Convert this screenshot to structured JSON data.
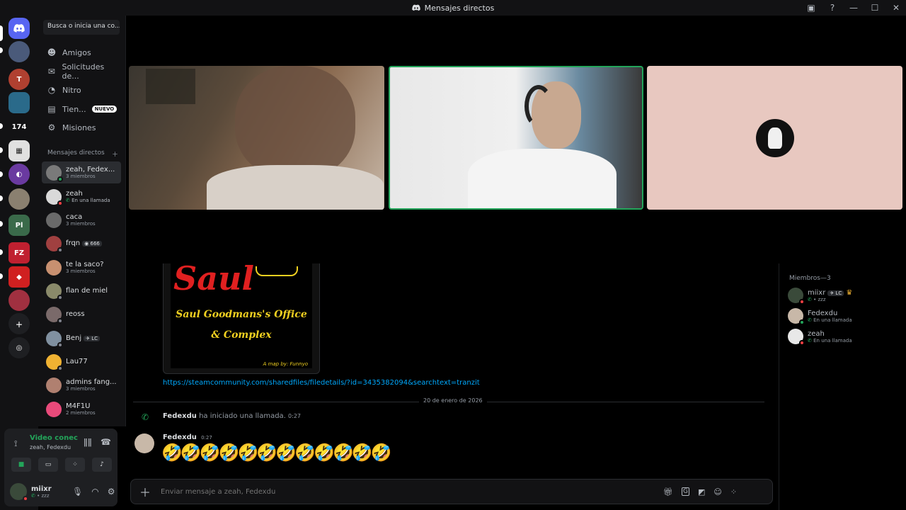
{
  "titlebar": {
    "title": "Mensajes directos"
  },
  "sidebar": {
    "search_label": "Busca o inicia una co...",
    "nav": [
      {
        "label": "Amigos",
        "icon": "friends-icon"
      },
      {
        "label": "Solicitudes de...",
        "icon": "mail-icon"
      },
      {
        "label": "Nitro",
        "icon": "nitro-icon"
      },
      {
        "label": "Tien...",
        "icon": "shop-icon",
        "badge": "NUEVO"
      },
      {
        "label": "Misiones",
        "icon": "quests-icon"
      }
    ],
    "dm_header": "Mensajes directos",
    "dms": [
      {
        "name": "zeah, Fedex...",
        "sub": "3 miembros",
        "color": "#7a7a7a"
      },
      {
        "name": "zeah",
        "sub": "En una llamada",
        "color": "#d9d9d9"
      },
      {
        "name": "caca",
        "sub": "3 miembros",
        "color": "#6a6a6a"
      },
      {
        "name": "frqn",
        "sub": "",
        "tag": "666",
        "color": "#a04040"
      },
      {
        "name": "te la saco?",
        "sub": "3 miembros",
        "color": "#c89070"
      },
      {
        "name": "flan de miel",
        "sub": "",
        "color": "#8a8a6a"
      },
      {
        "name": "reoss",
        "sub": "",
        "color": "#7a6a6a"
      },
      {
        "name": "Benj",
        "sub": "",
        "tag": "LC",
        "color": "#8090a0"
      },
      {
        "name": "Lau77",
        "sub": "",
        "color": "#f0b232"
      },
      {
        "name": "admins fang...",
        "sub": "3 miembros",
        "color": "#b08070"
      },
      {
        "name": "M4F1U",
        "sub": "2 miembros",
        "color": "#e84a7a"
      }
    ]
  },
  "voice": {
    "status": "Video conectado",
    "channel": "zeah, Fedexdu"
  },
  "user": {
    "name": "miixr",
    "status": "zzz"
  },
  "chat": {
    "image_caption_1": "Saul Goodmans's Office",
    "image_caption_2": "& Complex",
    "image_title": "Saul",
    "image_credit": "A map by: Funnyo",
    "link": "https://steamcommunity.com/sharedfiles/filedetails/?id=3435382094&searchtext=tranzit",
    "date_divider": "20 de enero de 2026",
    "system_user": "Fedexdu",
    "system_text": "ha iniciado una llamada.",
    "system_time": "0:27",
    "message_author": "Fedexdu",
    "message_time": "0:27",
    "message_emoji": "🤣🤣🤣🤣🤣🤣🤣🤣🤣🤣🤣🤣",
    "composer_placeholder": "Enviar mensaje a zeah, Fedexdu"
  },
  "members": {
    "header": "Miembros—3",
    "list": [
      {
        "name": "miixr",
        "sub": "zzz",
        "tag": "LC",
        "color": "#3a4a3a"
      },
      {
        "name": "Fedexdu",
        "sub": "En una llamada",
        "color": "#c8b8a8"
      },
      {
        "name": "zeah",
        "sub": "En una llamada",
        "color": "#e8e8e8"
      }
    ]
  },
  "colors": {
    "accent": "#5865f2",
    "online": "#23a55a",
    "dnd": "#f23f43",
    "link": "#00a8fc",
    "speaking": "#23a55a"
  }
}
